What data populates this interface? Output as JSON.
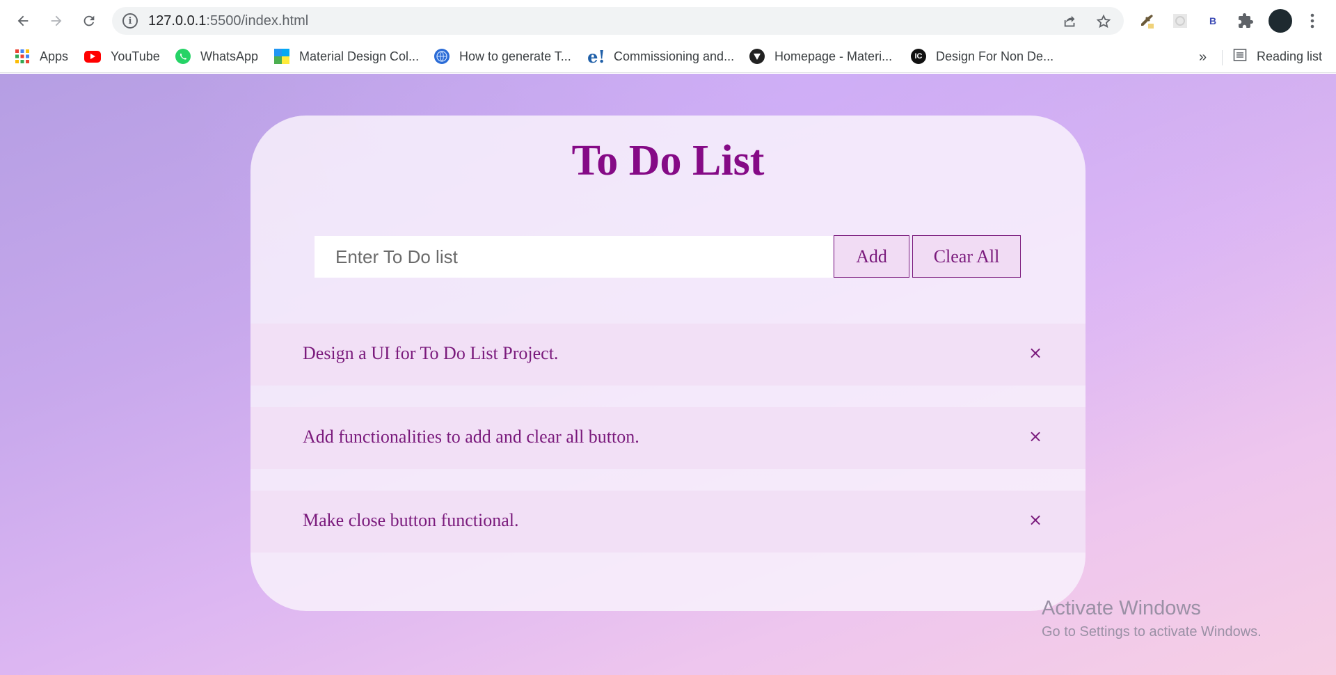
{
  "browser": {
    "url_host": "127.0.0.1",
    "url_path": ":5500/index.html",
    "bookmarks": [
      {
        "label": "Apps",
        "icon": "apps-grid-icon"
      },
      {
        "label": "YouTube",
        "icon": "youtube-icon"
      },
      {
        "label": "WhatsApp",
        "icon": "whatsapp-icon"
      },
      {
        "label": "Material Design Col...",
        "icon": "material-design-icon"
      },
      {
        "label": "How to generate T...",
        "icon": "globe-icon"
      },
      {
        "label": "Commissioning and...",
        "icon": "e-icon"
      },
      {
        "label": "Homepage - Materi...",
        "icon": "material-homepage-icon"
      },
      {
        "label": "Design For Non De...",
        "icon": "design-icon"
      }
    ],
    "overflow": "»",
    "reading_list": "Reading list",
    "extension_b": "B"
  },
  "app": {
    "title": "To Do List",
    "input_placeholder": "Enter To Do list",
    "add_label": "Add",
    "clear_label": "Clear All",
    "todos": [
      {
        "text": "Design a UI for To Do List Project.",
        "close": "×"
      },
      {
        "text": "Add functionalities to add and clear all button.",
        "close": "×"
      },
      {
        "text": "Make close button functional.",
        "close": "×"
      }
    ]
  },
  "watermark": {
    "line1": "Activate Windows",
    "line2": "Go to Settings to activate Windows."
  }
}
